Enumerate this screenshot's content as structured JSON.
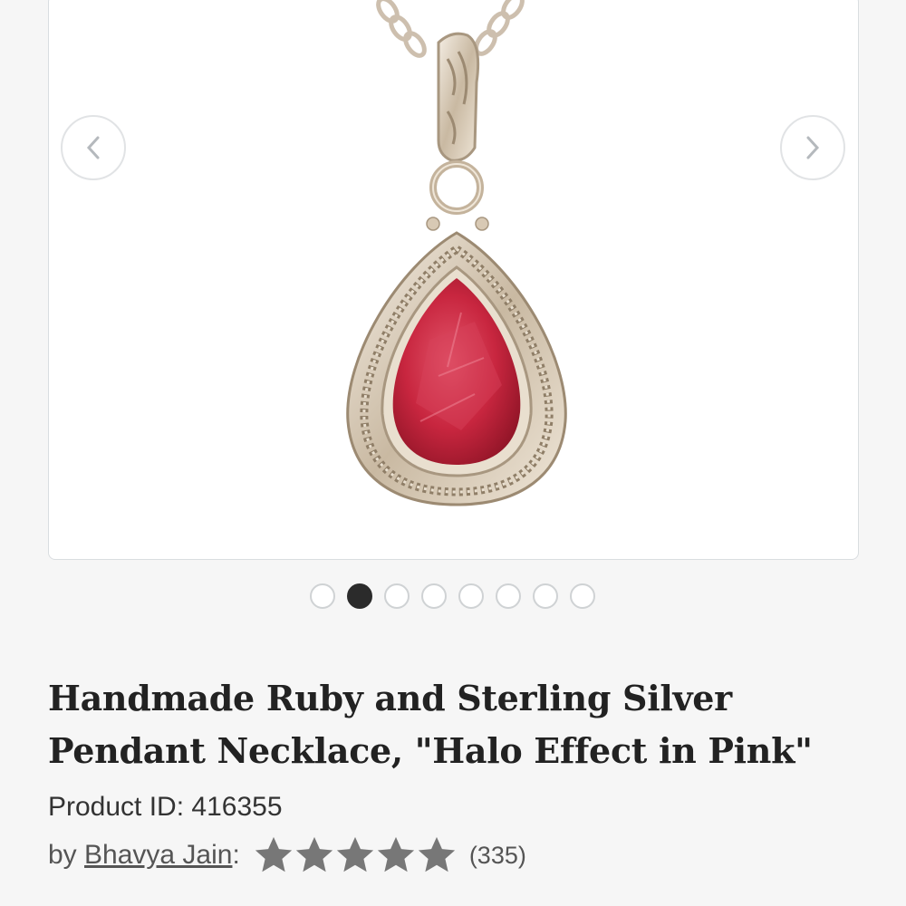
{
  "gallery": {
    "prev_arrow": "‹",
    "next_arrow": "›",
    "slide_count": 8,
    "active_slide": 2,
    "image_subject": "ruby-teardrop-pendant-necklace",
    "gem_color": "#c8263f"
  },
  "product": {
    "title_line1": "Handmade Ruby and Sterling Silver",
    "title_line2": "Pendant Necklace, \"Halo Effect in Pink\"",
    "id_label": "Product ID:",
    "id_value": "416355",
    "by_label": "by",
    "artist": "Bhavya Jain",
    "artist_suffix": ":",
    "rating": 5,
    "rating_max": 5,
    "review_count": "(335)"
  },
  "colors": {
    "star": "#777777",
    "active_dot": "#2b2b2b",
    "title": "#222222"
  }
}
